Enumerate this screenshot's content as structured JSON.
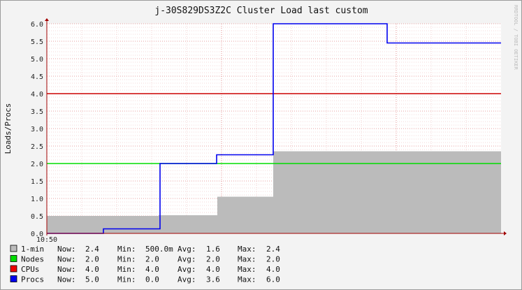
{
  "window": {
    "title": "j-30S829DS3Z2C Cluster Load last custom",
    "side_credit": "RRDTOOL / TOBI OETIKER"
  },
  "colors": {
    "background": "#f3f3f3",
    "plot_bg": "#ffffff",
    "area_1min": "#bbbbbb",
    "line_nodes": "#00dd00",
    "line_cpus": "#cc0000",
    "line_procs": "#0000ee",
    "grid_major": "#e08080",
    "grid_minor": "#e8b0b0",
    "axis": "#a00000"
  },
  "chart_data": {
    "type": "area",
    "title": "j-30S829DS3Z2C Cluster Load last custom",
    "xlabel": "",
    "ylabel": "Loads/Procs",
    "x_tick_labels": [
      "10:50"
    ],
    "x_range_steps": [
      0,
      130
    ],
    "ylim": [
      0,
      6
    ],
    "y_ticks": [
      "0.0",
      "0.5",
      "1.0",
      "1.5",
      "2.0",
      "2.5",
      "3.0",
      "3.5",
      "4.0",
      "4.5",
      "5.0",
      "5.5",
      "6.0"
    ],
    "grid": true,
    "series": [
      {
        "name": "1-min",
        "kind": "area",
        "color": "#bbbbbb",
        "steps": [
          [
            0,
            0.5
          ],
          [
            32,
            0.52
          ],
          [
            48.8,
            1.05
          ],
          [
            64.8,
            2.35
          ],
          [
            130,
            2.35
          ]
        ]
      },
      {
        "name": "Nodes",
        "kind": "line",
        "color": "#00dd00",
        "steps": [
          [
            0,
            2.0
          ],
          [
            130,
            2.0
          ]
        ]
      },
      {
        "name": "CPUs",
        "kind": "line",
        "color": "#cc0000",
        "steps": [
          [
            0,
            4.0
          ],
          [
            130,
            4.0
          ]
        ]
      },
      {
        "name": "Procs",
        "kind": "line",
        "color": "#0000ee",
        "steps": [
          [
            0,
            0.0
          ],
          [
            16.2,
            0.13
          ],
          [
            32.4,
            2.0
          ],
          [
            48.6,
            2.25
          ],
          [
            64.8,
            6.0
          ],
          [
            97.4,
            5.45
          ],
          [
            130,
            5.45
          ]
        ]
      }
    ],
    "legend": [
      {
        "name": "1-min",
        "color": "#bbbbbb",
        "now": "2.4",
        "min": "500.0m",
        "avg": "1.6",
        "max": "2.4"
      },
      {
        "name": "Nodes",
        "color": "#00dd00",
        "now": "2.0",
        "min": "2.0",
        "avg": "2.0",
        "max": "2.0"
      },
      {
        "name": "CPUs",
        "color": "#ee0000",
        "now": "4.0",
        "min": "4.0",
        "avg": "4.0",
        "max": "4.0"
      },
      {
        "name": "Procs",
        "color": "#0000ee",
        "now": "5.0",
        "min": "0.0",
        "avg": "3.6",
        "max": "6.0"
      }
    ],
    "legend_labels": {
      "now": "Now:",
      "min": "Min:",
      "avg": "Avg:",
      "max": "Max:"
    },
    "legend_placement": "bottom"
  }
}
